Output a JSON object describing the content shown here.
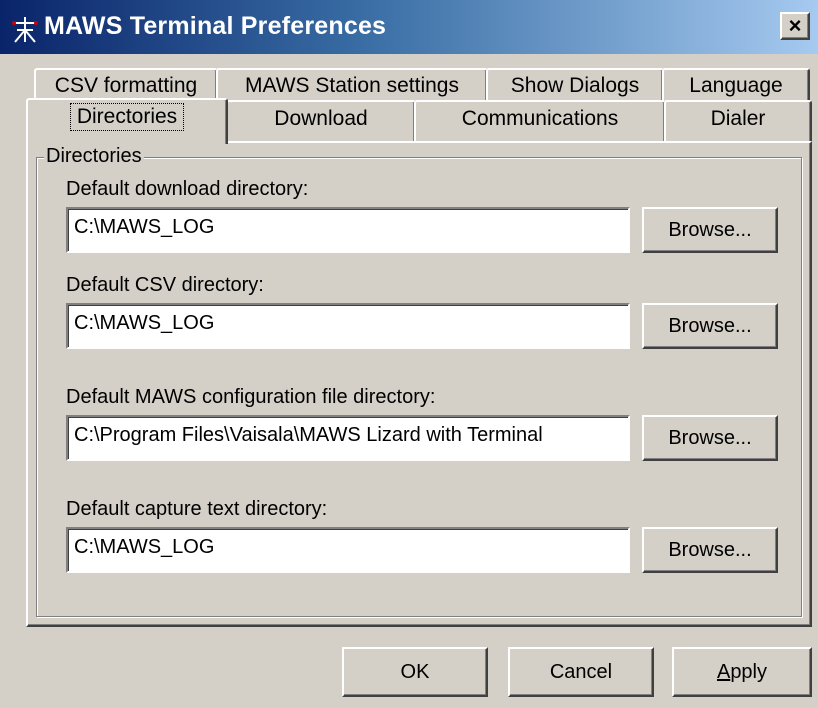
{
  "window": {
    "title": "MAWS Terminal Preferences",
    "close_glyph": "×",
    "title_icon": "maws-station-icon"
  },
  "tabs": {
    "row1": [
      "CSV formatting",
      "MAWS Station settings",
      "Show Dialogs",
      "Language"
    ],
    "row2": [
      "Directories",
      "Download",
      "Communications",
      "Dialer"
    ],
    "active": "Directories"
  },
  "directories": {
    "group_label": "Directories",
    "download": {
      "label": "Default download directory:",
      "value": "C:\\MAWS_LOG",
      "browse": "Browse..."
    },
    "csv": {
      "label": "Default CSV directory:",
      "value": "C:\\MAWS_LOG",
      "browse": "Browse..."
    },
    "config": {
      "label": "Default MAWS configuration file directory:",
      "value": "C:\\Program Files\\Vaisala\\MAWS Lizard with Terminal",
      "browse": "Browse..."
    },
    "capture": {
      "label": "Default capture text directory:",
      "value": "C:\\MAWS_LOG",
      "browse": "Browse..."
    }
  },
  "footer": {
    "ok": "OK",
    "cancel": "Cancel",
    "apply_mnemonic": "A",
    "apply_rest": "pply"
  },
  "colors": {
    "titlebar_start": "#0a246a",
    "titlebar_end": "#a6caf0",
    "face": "#d4d0c8"
  }
}
